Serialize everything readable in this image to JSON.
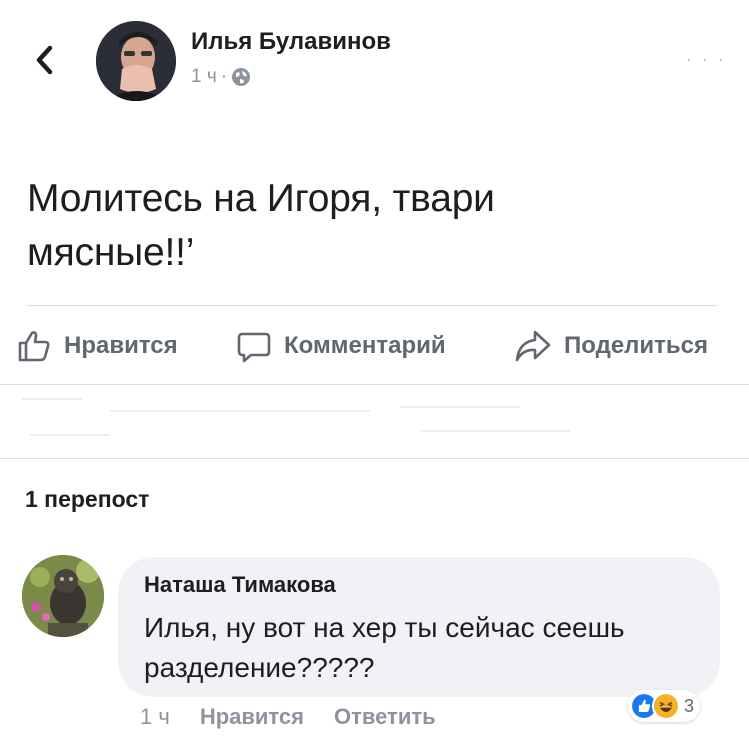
{
  "post": {
    "author_name": "Илья Булавинов",
    "time": "1 ч",
    "separator": "·",
    "privacy_icon": "globe-icon",
    "text_line1": "Молитесь на Игоря, твари",
    "text_line2": "мясные!!’"
  },
  "actions": {
    "like": "Нравится",
    "comment": "Комментарий",
    "share": "Поделиться"
  },
  "reposts": "1 перепост",
  "comment": {
    "author": "Наташа Тимакова",
    "text_line1": "Илья, ну вот на хер ты сейчас сеешь",
    "text_line2": "разделение?????",
    "time": "1 ч",
    "like": "Нравится",
    "reply": "Ответить",
    "reaction_count": "3"
  },
  "colors": {
    "accent": "#1877f2",
    "reaction_haha": "#f7b125",
    "muted_text": "#8d949e",
    "action_text": "#606770",
    "bubble": "#f0f2f5"
  }
}
